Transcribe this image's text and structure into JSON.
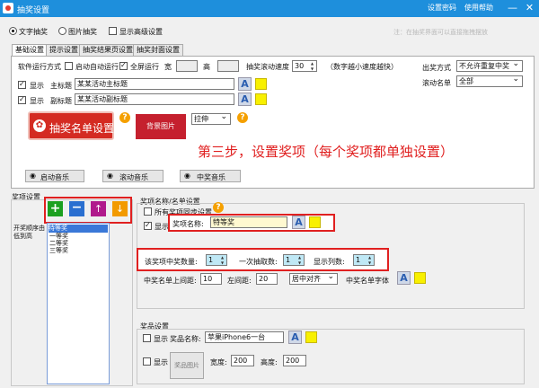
{
  "window": {
    "title": "抽奖设置",
    "link_password": "设置密码",
    "link_help": "使用帮助",
    "min_glyph": "—",
    "close_glyph": "✕"
  },
  "mode": {
    "text_label": "文字抽奖",
    "image_label": "图片抽奖",
    "advanced_label": "显示高级设置",
    "note": "注：在抽奖界面可以直接拖拽摆放"
  },
  "tabs": [
    "基础设置",
    "提示设置",
    "抽奖结果页设置",
    "抽奖封面设置"
  ],
  "basic": {
    "run_mode_label": "软件运行方式",
    "auto_start": "启动自动运行",
    "fullscreen": "全屏运行",
    "width_label": "宽",
    "height_label": "高",
    "scroll_speed_label": "抽奖滚动速度",
    "scroll_speed_value": "30",
    "scroll_speed_hint": "（数字越小速度越快）",
    "prize_mode_label": "出奖方式",
    "prize_mode_value": "不允许重复中奖",
    "scroll_list_label": "滚动名单",
    "scroll_list_value": "全部",
    "show_label": "显示",
    "main_title_label": "主标题",
    "main_title_value": "某某活动主标题",
    "sub_title_label": "副标题",
    "sub_title_value": "某某活动副标题",
    "list_button": "抽奖名单设置",
    "bg_button": "背景图片",
    "stretch_value": "拉伸",
    "music_start": "启动音乐",
    "music_scroll": "滚动音乐",
    "music_win": "中奖音乐"
  },
  "annotation": "第三步，设置奖项（每个奖项都单独设置）",
  "prize_settings": {
    "group_label": "奖项设置",
    "order_label": "开奖顺序由低到高",
    "items": [
      "特等奖",
      "一等奖",
      "二等奖",
      "三等奖"
    ]
  },
  "prize_detail": {
    "group_label": "奖项名称/名单设置",
    "all_prizes_label": "所有奖项同步设置",
    "show_label": "显示",
    "name_label": "奖项名称:",
    "name_value": "特等奖",
    "count_label": "该奖项中奖数量:",
    "count_value": "1",
    "draw_once_label": "一次抽取数:",
    "draw_once_value": "1",
    "columns_label": "显示列数:",
    "columns_value": "1",
    "line_gap_label": "中奖名单上间距:",
    "line_gap_value": "10",
    "left_gap_label": "左间距:",
    "left_gap_value": "20",
    "align_value": "居中对齐",
    "font_label": "中奖名单字体"
  },
  "prize_goods": {
    "group_label": "奖品设置",
    "show_label": "显示",
    "name_label": "奖品名称:",
    "name_value": "苹果iPhone6一台",
    "image_label": "奖品图片",
    "width_label": "宽度:",
    "width_value": "200",
    "height_label": "高度:",
    "height_value": "200"
  },
  "colors": {
    "titlebar": "#1e8fdc",
    "annotation": "#e02020",
    "highlight_box": "#e02020",
    "list_button": "#d42b22",
    "font_color_swatch": "#f8f000"
  }
}
